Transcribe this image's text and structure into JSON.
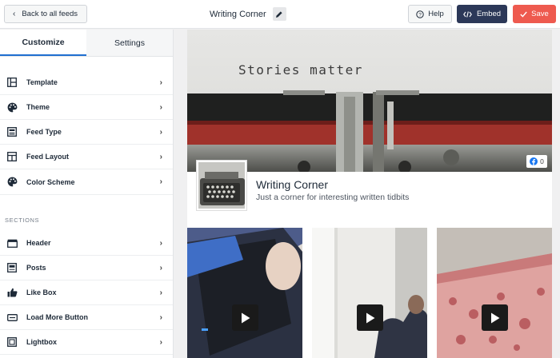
{
  "topbar": {
    "back_label": "Back to all feeds",
    "feed_title": "Writing Corner",
    "help_label": "Help",
    "embed_label": "Embed",
    "save_label": "Save"
  },
  "sidebar": {
    "tabs": [
      {
        "label": "Customize",
        "active": true
      },
      {
        "label": "Settings",
        "active": false
      }
    ],
    "items": [
      {
        "label": "Template",
        "icon": "template-icon"
      },
      {
        "label": "Theme",
        "icon": "palette-icon"
      },
      {
        "label": "Feed Type",
        "icon": "feed-type-icon"
      },
      {
        "label": "Feed Layout",
        "icon": "layout-icon"
      },
      {
        "label": "Color Scheme",
        "icon": "palette-icon"
      }
    ],
    "sections_label": "SECTIONS",
    "section_items": [
      {
        "label": "Header",
        "icon": "header-icon"
      },
      {
        "label": "Posts",
        "icon": "posts-icon"
      },
      {
        "label": "Like Box",
        "icon": "thumbs-up-icon"
      },
      {
        "label": "Load More Button",
        "icon": "button-icon"
      },
      {
        "label": "Lightbox",
        "icon": "lightbox-icon"
      }
    ]
  },
  "preview": {
    "cover_text": "Stories matter",
    "like_count": "0",
    "page_name": "Writing Corner",
    "page_description": "Just a corner for interesting written tidbits"
  },
  "colors": {
    "accent_blue": "#1f6fd0",
    "embed_bg": "#2c3858",
    "save_bg": "#ee5a4f"
  }
}
